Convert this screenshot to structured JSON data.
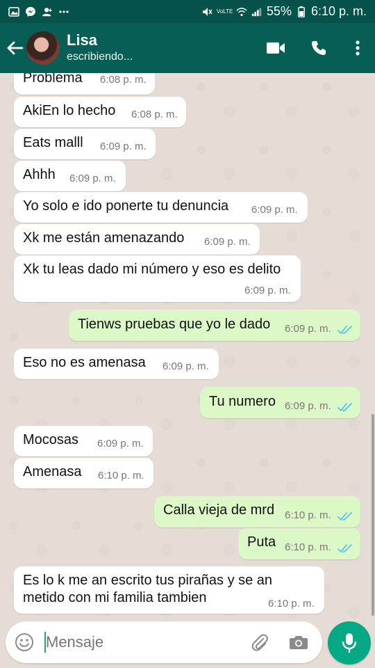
{
  "status_bar": {
    "icons_left": [
      "image-icon",
      "messenger-icon",
      "add-user-icon",
      "more-dots-icon"
    ],
    "icons_right": [
      "mute-icon",
      "volte-icon",
      "wifi-icon",
      "signal-icon",
      "battery-icon"
    ],
    "volte_label": "VoLTE",
    "battery": "55%",
    "time": "6:10 p. m."
  },
  "header": {
    "contact_name": "Lisa",
    "status": "escribiendo..."
  },
  "messages": [
    {
      "dir": "in",
      "text": "Problema",
      "time": "6:08 p. m."
    },
    {
      "dir": "in",
      "text": "AkiEn lo hecho",
      "time": "6:08 p. m."
    },
    {
      "dir": "in",
      "text": "Eats malll",
      "time": "6:09 p. m."
    },
    {
      "dir": "in",
      "text": "Ahhh",
      "time": "6:09 p. m."
    },
    {
      "dir": "in",
      "text": "Yo solo e ido ponerte tu denuncia",
      "time": "6:09 p. m."
    },
    {
      "dir": "in",
      "text": "Xk me están amenazando",
      "time": "6:09 p. m."
    },
    {
      "dir": "in",
      "text": "Xk tu leas dado mi número y eso es delito",
      "time": "6:09 p. m."
    },
    {
      "dir": "out",
      "text": "Tienws pruebas que yo le dado",
      "time": "6:09 p. m."
    },
    {
      "dir": "in",
      "text": "Eso no es amenasa",
      "time": "6:09 p. m."
    },
    {
      "dir": "out",
      "text": "Tu numero",
      "time": "6:09 p. m."
    },
    {
      "dir": "in",
      "text": "Mocosas",
      "time": "6:09 p. m."
    },
    {
      "dir": "in",
      "text": "Amenasa",
      "time": "6:10 p. m."
    },
    {
      "dir": "out",
      "text": "Calla vieja de mrd",
      "time": "6:10 p. m."
    },
    {
      "dir": "out",
      "text": "Puta",
      "time": "6:10 p. m."
    },
    {
      "dir": "in",
      "text_line1": "Es lo k me an escrito tus pirañas y se an",
      "text_line2": "metido con mi familia tambien",
      "time": "6:10 p. m."
    }
  ],
  "composer": {
    "placeholder": "Mensaje"
  },
  "colors": {
    "header": "#075e54",
    "status_bar": "#05524a",
    "chat_bg": "#e5ddd5",
    "outgoing_bubble": "#dcf8c6",
    "incoming_bubble": "#ffffff",
    "read_ticks": "#4fc3f7",
    "mic_button": "#05a884"
  }
}
